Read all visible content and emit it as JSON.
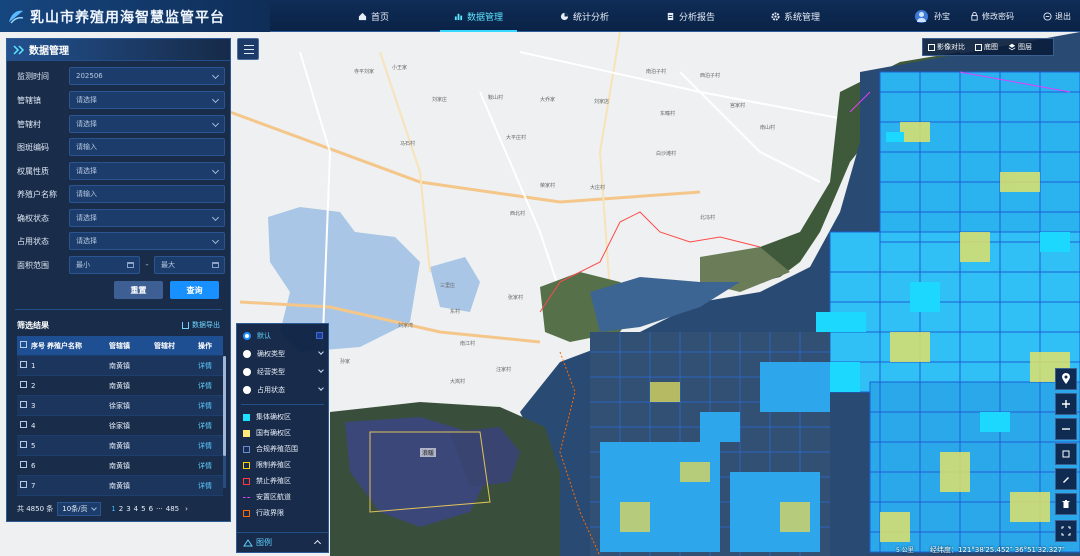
{
  "header": {
    "app_title": "乳山市养殖用海智慧监管平台",
    "nav": [
      {
        "label": "首页",
        "icon": "home-icon",
        "active": false
      },
      {
        "label": "数据管理",
        "icon": "bar-chart-icon",
        "active": true
      },
      {
        "label": "统计分析",
        "icon": "pie-chart-icon",
        "active": false
      },
      {
        "label": "分析报告",
        "icon": "document-icon",
        "active": false
      },
      {
        "label": "系统管理",
        "icon": "gear-icon",
        "active": false
      }
    ],
    "user_name": "孙宝",
    "change_password": "修改密码",
    "logout": "退出"
  },
  "panel": {
    "title": "数据管理",
    "filters": [
      {
        "label": "监测时间",
        "value": "202506",
        "type": "select"
      },
      {
        "label": "管辖镇",
        "value": "请选择",
        "type": "select"
      },
      {
        "label": "管辖村",
        "value": "请选择",
        "type": "select"
      },
      {
        "label": "图斑编码",
        "value": "请输入",
        "type": "input"
      },
      {
        "label": "权属性质",
        "value": "请选择",
        "type": "select"
      },
      {
        "label": "养殖户名称",
        "value": "请输入",
        "type": "input"
      },
      {
        "label": "确权状态",
        "value": "请选择",
        "type": "select"
      },
      {
        "label": "占用状态",
        "value": "请选择",
        "type": "select"
      }
    ],
    "area_range": {
      "label": "面积范围",
      "min_placeholder": "最小",
      "max_placeholder": "最大",
      "separator": "-"
    },
    "reset_label": "重置",
    "query_label": "查询",
    "result_title": "筛选结果",
    "export_label": "数据导出",
    "table": {
      "headers": [
        "序号",
        "养殖户名称",
        "管辖镇",
        "管辖村",
        "操作"
      ],
      "rows": [
        {
          "no": "1",
          "owner": "",
          "town": "南黄镇",
          "village": "",
          "action": "详情"
        },
        {
          "no": "2",
          "owner": "",
          "town": "南黄镇",
          "village": "",
          "action": "详情"
        },
        {
          "no": "3",
          "owner": "",
          "town": "徐家镇",
          "village": "",
          "action": "详情"
        },
        {
          "no": "4",
          "owner": "",
          "town": "徐家镇",
          "village": "",
          "action": "详情"
        },
        {
          "no": "5",
          "owner": "",
          "town": "南黄镇",
          "village": "",
          "action": "详情"
        },
        {
          "no": "6",
          "owner": "",
          "town": "南黄镇",
          "village": "",
          "action": "详情"
        },
        {
          "no": "7",
          "owner": "",
          "town": "南黄镇",
          "village": "",
          "action": "详情"
        }
      ]
    },
    "pager": {
      "total": "共 4850 条",
      "page_size": "10条/页",
      "pages": [
        "1",
        "2",
        "3",
        "4",
        "5",
        "6",
        "···",
        "485"
      ],
      "current_page": "1",
      "next": "›"
    }
  },
  "legend": {
    "title": "图例",
    "layers": [
      {
        "label": "默认",
        "selected": true
      },
      {
        "label": "确权类型",
        "selected": false
      },
      {
        "label": "经营类型",
        "selected": false
      },
      {
        "label": "占用状态",
        "selected": false
      }
    ],
    "items": [
      {
        "label": "集体确权区",
        "color": "#1ee0ff"
      },
      {
        "label": "国有确权区",
        "color": "#ffe97a"
      },
      {
        "label": "合规养殖范围",
        "color": "#1a2b55"
      },
      {
        "label": "限制养殖区",
        "color": "#ffd000"
      },
      {
        "label": "禁止养殖区",
        "color": "#ff3b3b"
      },
      {
        "label": "安置区航道",
        "color": "#e040fb"
      },
      {
        "label": "行政界限",
        "color": "#ff6a00"
      }
    ]
  },
  "map_tools": [
    {
      "label": "影像对比",
      "icon": "compare-icon"
    },
    {
      "label": "底图",
      "icon": "basemap-icon"
    },
    {
      "label": "图层",
      "icon": "layers-icon"
    }
  ],
  "map": {
    "coords": "经纬度：121°38′25.452″ 36°51′32.327″",
    "scale": "5 公里",
    "zone_label": "浪暖",
    "places": [
      "寺平刘家",
      "小王家",
      "刘家庄",
      "鞍山村",
      "大乔家",
      "刘家店",
      "南泊子村",
      "西泊子村",
      "马石村",
      "大平庄村",
      "东疃村",
      "宫家村",
      "南山村",
      "白沙滩村",
      "荣家村",
      "大庄村",
      "西北村",
      "北冯村",
      "三里庄",
      "张家村",
      "东村",
      "刘家湾",
      "南江村",
      "孙家",
      "大岚村",
      "汪家村"
    ]
  },
  "colors": {
    "accent": "#38d8ff",
    "primary_button": "#1890ff",
    "panel_bg": "#0c2040"
  }
}
